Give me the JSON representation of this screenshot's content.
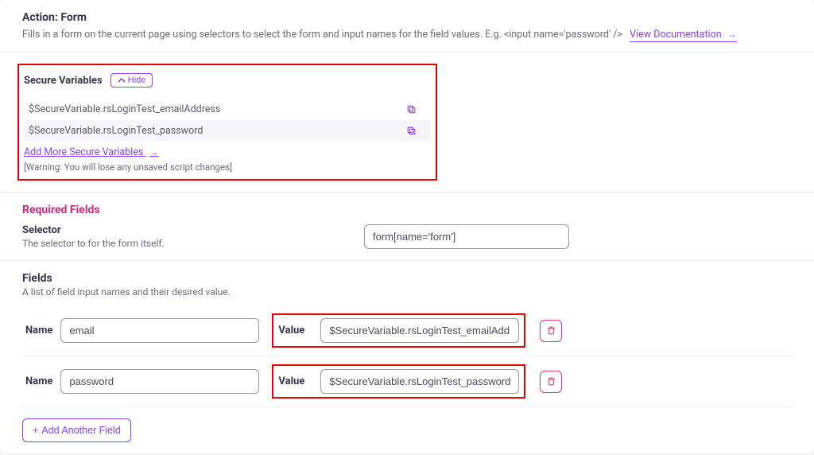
{
  "header": {
    "title": "Action: Form",
    "description": "Fills in a form on the current page using selectors to select the form and input names for the field values. E.g. <input name='password' />",
    "doc_link": "View Documentation"
  },
  "secure_vars": {
    "label": "Secure Variables",
    "hide_label": "Hide",
    "items": [
      "$SecureVariable.rsLoginTest_emailAddress",
      "$SecureVariable.rsLoginTest_password"
    ],
    "add_more": "Add More Secure Variables",
    "warning": "[Warning: You will lose any unsaved script changes]"
  },
  "required": {
    "title": "Required Fields",
    "selector_label": "Selector",
    "selector_desc": "The selector to for the form itself.",
    "selector_value": "form[name='form']"
  },
  "fields_section": {
    "title": "Fields",
    "desc": "A list of field input names and their desired value.",
    "name_label": "Name",
    "value_label": "Value",
    "rows": [
      {
        "name": "email",
        "value": "$SecureVariable.rsLoginTest_emailAddress"
      },
      {
        "name": "password",
        "value": "$SecureVariable.rsLoginTest_password"
      }
    ],
    "add_button": "Add Another Field"
  }
}
